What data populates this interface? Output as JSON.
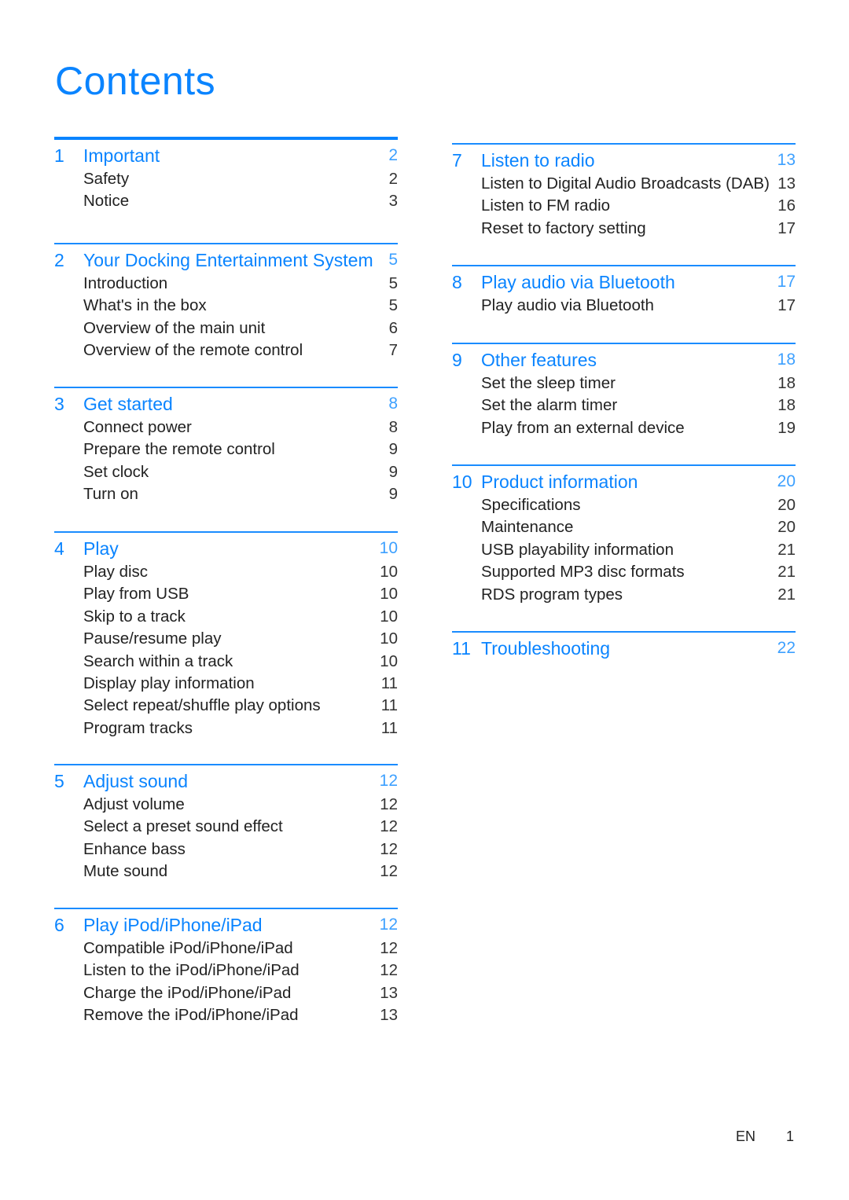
{
  "title": "Contents",
  "left_column": [
    {
      "number": "1",
      "title": "Important",
      "page": "2",
      "items": [
        {
          "label": "Safety",
          "page": "2"
        },
        {
          "label": "Notice",
          "page": "3"
        }
      ]
    },
    {
      "number": "2",
      "title": "Your Docking Entertainment System",
      "page": "5",
      "items": [
        {
          "label": "Introduction",
          "page": "5"
        },
        {
          "label": "What's in the box",
          "page": "5"
        },
        {
          "label": "Overview of the main unit",
          "page": "6"
        },
        {
          "label": "Overview of the remote control",
          "page": "7"
        }
      ]
    },
    {
      "number": "3",
      "title": "Get started",
      "page": "8",
      "items": [
        {
          "label": "Connect power",
          "page": "8"
        },
        {
          "label": "Prepare the remote control",
          "page": "9"
        },
        {
          "label": "Set clock",
          "page": "9"
        },
        {
          "label": "Turn on",
          "page": "9"
        }
      ]
    },
    {
      "number": "4",
      "title": "Play",
      "page": "10",
      "items": [
        {
          "label": "Play disc",
          "page": "10"
        },
        {
          "label": "Play from USB",
          "page": "10"
        },
        {
          "label": "Skip to a track",
          "page": "10"
        },
        {
          "label": "Pause/resume play",
          "page": "10"
        },
        {
          "label": "Search within a track",
          "page": "10"
        },
        {
          "label": "Display play information",
          "page": "11"
        },
        {
          "label": "Select repeat/shuffle play options",
          "page": "11"
        },
        {
          "label": "Program tracks",
          "page": "11"
        }
      ]
    },
    {
      "number": "5",
      "title": "Adjust sound",
      "page": "12",
      "items": [
        {
          "label": "Adjust volume",
          "page": "12"
        },
        {
          "label": "Select a preset sound effect",
          "page": "12"
        },
        {
          "label": "Enhance bass",
          "page": "12"
        },
        {
          "label": "Mute sound",
          "page": "12"
        }
      ]
    },
    {
      "number": "6",
      "title": "Play iPod/iPhone/iPad",
      "page": "12",
      "items": [
        {
          "label": "Compatible iPod/iPhone/iPad",
          "page": "12"
        },
        {
          "label": "Listen to the iPod/iPhone/iPad",
          "page": "12"
        },
        {
          "label": "Charge the iPod/iPhone/iPad",
          "page": "13"
        },
        {
          "label": "Remove the iPod/iPhone/iPad",
          "page": "13"
        }
      ]
    }
  ],
  "right_column": [
    {
      "number": "7",
      "title": "Listen to radio",
      "page": "13",
      "items": [
        {
          "label": "Listen to Digital Audio Broadcasts (DAB)",
          "page": "13"
        },
        {
          "label": "Listen to FM radio",
          "page": "16"
        },
        {
          "label": "Reset to factory setting",
          "page": "17"
        }
      ]
    },
    {
      "number": "8",
      "title": "Play audio via Bluetooth",
      "page": "17",
      "items": [
        {
          "label": "Play audio via Bluetooth",
          "page": "17"
        }
      ]
    },
    {
      "number": "9",
      "title": "Other features",
      "page": "18",
      "items": [
        {
          "label": "Set the sleep timer",
          "page": "18"
        },
        {
          "label": "Set the alarm timer",
          "page": "18"
        },
        {
          "label": "Play from an external device",
          "page": "19"
        }
      ]
    },
    {
      "number": "10",
      "title": "Product information",
      "page": "20",
      "items": [
        {
          "label": "Specifications",
          "page": "20"
        },
        {
          "label": "Maintenance",
          "page": "20"
        },
        {
          "label": "USB playability information",
          "page": "21"
        },
        {
          "label": "Supported MP3 disc formats",
          "page": "21"
        },
        {
          "label": "RDS program types",
          "page": "21"
        }
      ]
    },
    {
      "number": "11",
      "title": "Troubleshooting",
      "page": "22",
      "items": []
    }
  ],
  "footer": {
    "language": "EN",
    "page_number": "1"
  }
}
